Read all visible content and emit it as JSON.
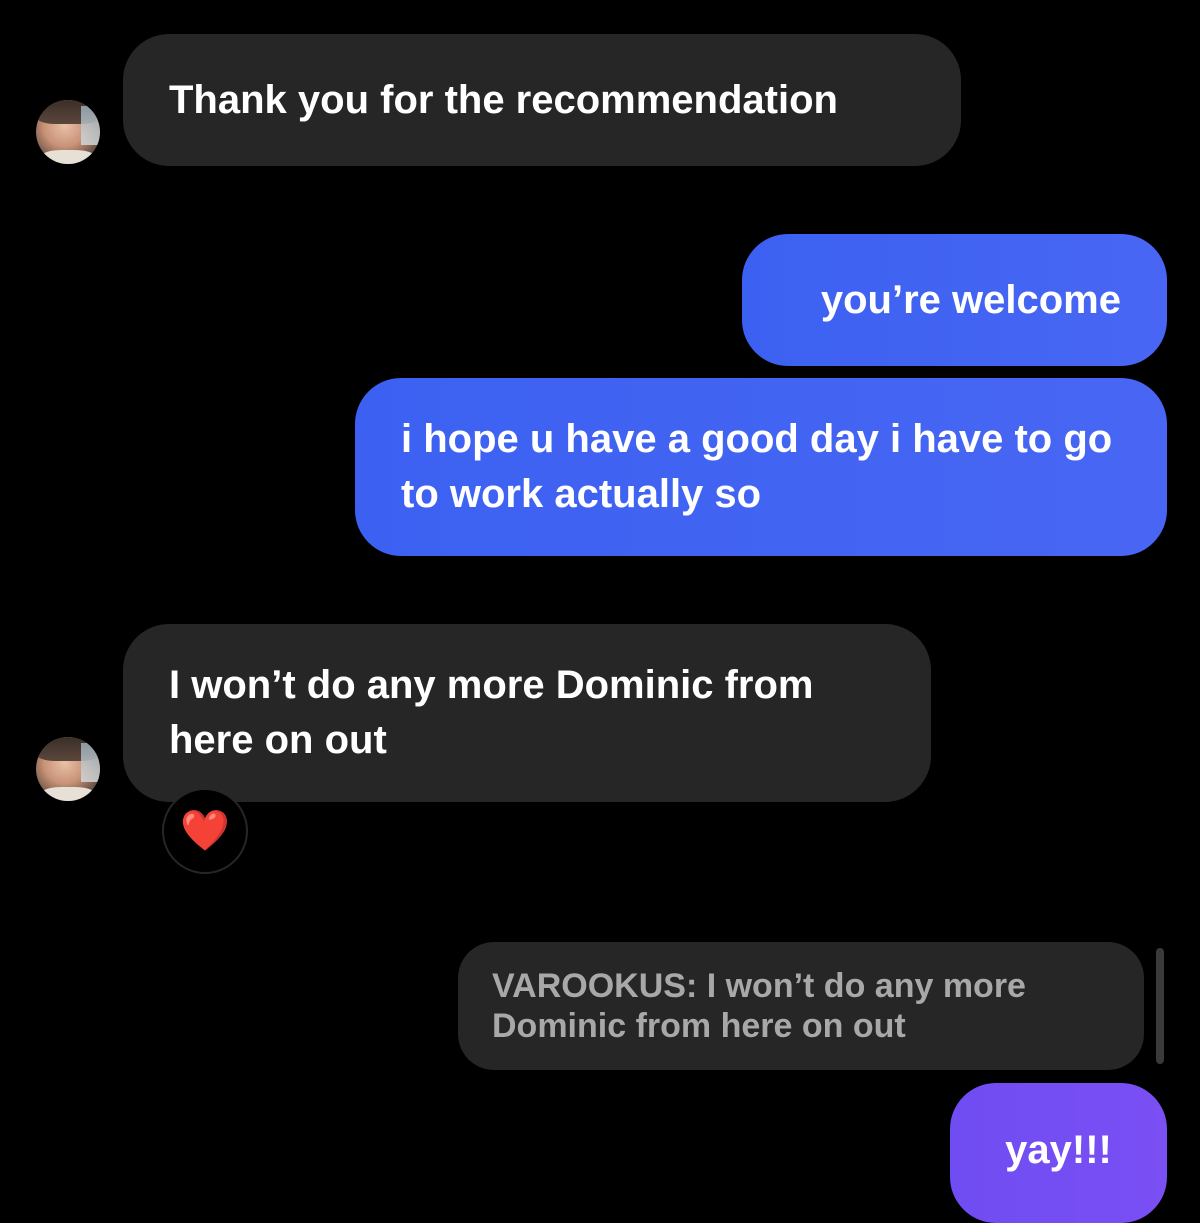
{
  "messages": [
    {
      "text": "Thank you for the recommendation"
    },
    {
      "text": "you’re welcome"
    },
    {
      "text": "i hope u have a good day i have to go to work actually so"
    },
    {
      "text": "I won’t do any more Dominic from here on out",
      "reaction": "❤️"
    },
    {
      "reply_to": "VAROOKUS: I won’t do any more Dominic from here on out",
      "text": "yay!!!"
    }
  ],
  "colors": {
    "background": "#000000",
    "incoming_bubble": "#262626",
    "outgoing_bubble": "#4865f3",
    "outgoing_bubble_last": "#7250f3",
    "quote_text": "#a8a8a8"
  },
  "icons": {
    "avatar": "user-avatar-photo",
    "reaction": "red-heart"
  }
}
